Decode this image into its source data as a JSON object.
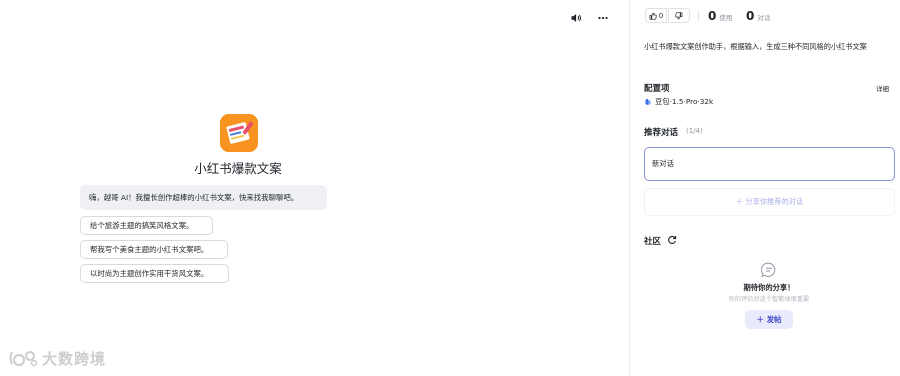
{
  "header": {
    "speaker_icon": "speaker-icon",
    "more_icon": "more-horizontal-icon"
  },
  "bot": {
    "name": "小红书爆款文案",
    "greeting": "嗨，越哥 AI！我擅长创作超棒的小红书文案，快来找我聊聊吧。",
    "suggestions": [
      "给个旅游主题的搞笑风格文案。",
      "帮我写个美食主题的小红书文案吧。",
      "以时尚为主题创作实用干货风文案。"
    ]
  },
  "watermark": {
    "text": "大数跨境"
  },
  "sidebar": {
    "likes": "0",
    "uses_value": "0",
    "uses_label": "使用",
    "chats_value": "0",
    "chats_label": "对话",
    "description": "小红书爆款文案创作助手，根据输入，生成三种不同风格的小红书文案",
    "config_title": "配置项",
    "detail_link": "详细",
    "model": "豆包·1.5·Pro·32k",
    "recommend_title": "推荐对话",
    "recommend_count": "(1/4)",
    "new_chat": "新对话",
    "share_label": "分享你推荐的对话",
    "community_title": "社区",
    "empty_title": "期待你的分享！",
    "empty_subtitle": "你的评价对这个智能体很重要",
    "post_label": "发帖"
  },
  "colors": {
    "accent": "#3f49c7",
    "avatar_bg": "#f7931e",
    "greeting_bg": "#eef0f4",
    "selected_border": "#8a93d8"
  }
}
